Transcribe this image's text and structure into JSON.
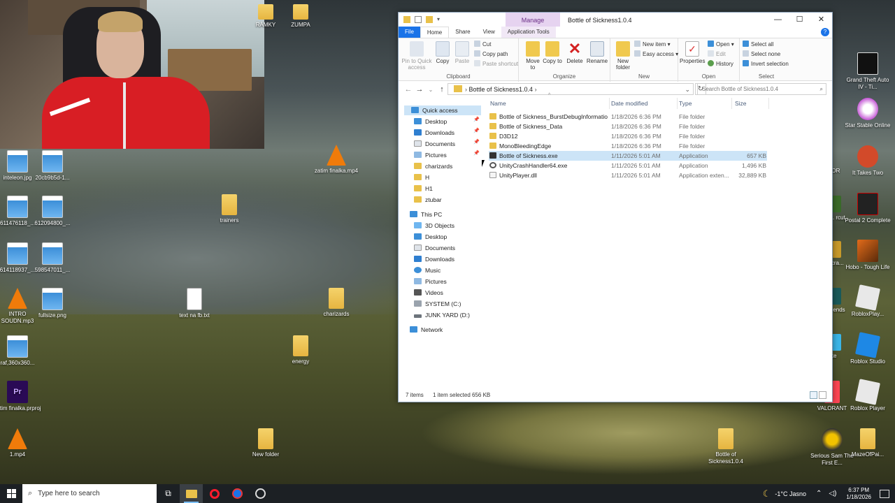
{
  "desktop_icons": [
    {
      "label": "inteleon.jpg",
      "icon": "image-icon"
    },
    {
      "label": "20cb9b5d-1...",
      "icon": "image-icon"
    },
    {
      "label": "zatim finalka.mp4",
      "icon": "vlc-icon"
    },
    {
      "label": "611476118_...",
      "icon": "image-icon"
    },
    {
      "label": "612094800_...",
      "icon": "image-icon"
    },
    {
      "label": "trainers",
      "icon": "folder-icon"
    },
    {
      "label": "614118937_...",
      "icon": "image-icon"
    },
    {
      "label": "598547011_...",
      "icon": "image-icon"
    },
    {
      "label": "INTRO SOUDN.mp3",
      "icon": "vlc-icon"
    },
    {
      "label": "fullsize.png",
      "icon": "image-icon"
    },
    {
      "label": "text na fb.txt",
      "icon": "text-file-icon"
    },
    {
      "label": "charizards",
      "icon": "folder-icon"
    },
    {
      "label": "raf,360x360...",
      "icon": "image-icon"
    },
    {
      "label": "energy",
      "icon": "folder-icon"
    },
    {
      "label": "zatim finalka.prproj",
      "icon": "premiere-icon"
    },
    {
      "label": "1.mp4",
      "icon": "vlc-icon"
    },
    {
      "label": "New folder",
      "icon": "folder-icon"
    },
    {
      "label": "Bottle of Sickness1.0.4",
      "icon": "folder-icon"
    },
    {
      "label": "RÁMKY",
      "icon": "folder-icon"
    },
    {
      "label": "ZUMPA",
      "icon": "folder-icon"
    },
    {
      "label": "Grand Theft Auto IV - Ti...",
      "icon": "gta-icon"
    },
    {
      "label": "Star Stable Online",
      "icon": "star-stable-icon"
    },
    {
      "label": "It Takes Two",
      "icon": "it-takes-two-icon"
    },
    {
      "label": "Postal 2 Complete",
      "icon": "postal-icon"
    },
    {
      "label": "Hobo - Tough Life",
      "icon": "hobo-icon"
    },
    {
      "label": "RobloxPlay...",
      "icon": "roblox-icon"
    },
    {
      "label": "Roblox Studio",
      "icon": "roblox-studio-icon"
    },
    {
      "label": "Roblox Player",
      "icon": "roblox-icon"
    },
    {
      "label": "VALORANT",
      "icon": "valorant-icon"
    },
    {
      "label": "Serious Sam The First E...",
      "icon": "serious-sam-icon"
    },
    {
      "label": "MazeOfPai...",
      "icon": "folder-icon"
    },
    {
      "label": "ROR",
      "icon": "app-icon"
    },
    {
      "label": "cher... rcut",
      "icon": "app-icon"
    },
    {
      "label": "d of cra...",
      "icon": "app-icon"
    },
    {
      "label": "ue of ends",
      "icon": "app-icon"
    },
    {
      "label": "nite",
      "icon": "app-icon"
    }
  ],
  "explorer": {
    "title": "Bottle of Sickness1.0.4",
    "context_tab": "Manage",
    "window_controls": [
      "—",
      "☐",
      "✕"
    ],
    "tabs": {
      "file": "File",
      "home": "Home",
      "share": "Share",
      "view": "View",
      "app_tools": "Application Tools"
    },
    "ribbon": {
      "clipboard": {
        "label": "Clipboard",
        "pin": "Pin to Quick access",
        "copy": "Copy",
        "paste": "Paste",
        "cut": "Cut",
        "copy_path": "Copy path",
        "paste_shortcut": "Paste shortcut"
      },
      "organize": {
        "label": "Organize",
        "move_to": "Move to",
        "copy_to": "Copy to",
        "delete": "Delete",
        "rename": "Rename"
      },
      "new": {
        "label": "New",
        "new_folder": "New folder",
        "new_item": "New item",
        "easy_access": "Easy access"
      },
      "open": {
        "label": "Open",
        "properties": "Properties",
        "open": "Open",
        "edit": "Edit",
        "history": "History"
      },
      "select": {
        "label": "Select",
        "select_all": "Select all",
        "select_none": "Select none",
        "invert": "Invert selection"
      }
    },
    "address": {
      "path": "Bottle of Sickness1.0.4",
      "search_placeholder": "Search Bottle of Sickness1.0.4"
    },
    "nav": {
      "quick_access": "Quick access",
      "quick_items": [
        "Desktop",
        "Downloads",
        "Documents",
        "Pictures",
        "charizards",
        "H",
        "H1",
        "ztubar"
      ],
      "this_pc": "This PC",
      "pc_items": [
        "3D Objects",
        "Desktop",
        "Documents",
        "Downloads",
        "Music",
        "Pictures",
        "Videos",
        "SYSTEM (C:)",
        "JUNK YARD (D:)"
      ],
      "network": "Network"
    },
    "columns": {
      "name": "Name",
      "date": "Date modified",
      "type": "Type",
      "size": "Size"
    },
    "files": [
      {
        "name": "Bottle of Sickness_BurstDebugInformatio...",
        "date": "1/18/2026 6:36 PM",
        "type": "File folder",
        "size": "",
        "icon": "folder-icon"
      },
      {
        "name": "Bottle of Sickness_Data",
        "date": "1/18/2026 6:36 PM",
        "type": "File folder",
        "size": "",
        "icon": "folder-icon"
      },
      {
        "name": "D3D12",
        "date": "1/18/2026 6:36 PM",
        "type": "File folder",
        "size": "",
        "icon": "folder-icon"
      },
      {
        "name": "MonoBleedingEdge",
        "date": "1/18/2026 6:36 PM",
        "type": "File folder",
        "size": "",
        "icon": "folder-icon"
      },
      {
        "name": "Bottle of Sickness.exe",
        "date": "1/11/2026 5:01 AM",
        "type": "Application",
        "size": "657 KB",
        "icon": "exe-icon"
      },
      {
        "name": "UnityCrashHandler64.exe",
        "date": "1/11/2026 5:01 AM",
        "type": "Application",
        "size": "1,496 KB",
        "icon": "gear-icon"
      },
      {
        "name": "UnityPlayer.dll",
        "date": "1/11/2026 5:01 AM",
        "type": "Application exten...",
        "size": "32,889 KB",
        "icon": "dll-icon"
      }
    ],
    "status": {
      "count": "7 items",
      "selected": "1 item selected  656 KB"
    }
  },
  "taskbar": {
    "search_placeholder": "Type here to search",
    "weather": "-1°C  Jasno",
    "time": "6:37 PM",
    "date": "1/18/2026"
  },
  "colors": {
    "accent": "#1a73e8",
    "selection": "#cce4f7",
    "folder": "#e9c14a",
    "taskbar": "#1c2024"
  }
}
